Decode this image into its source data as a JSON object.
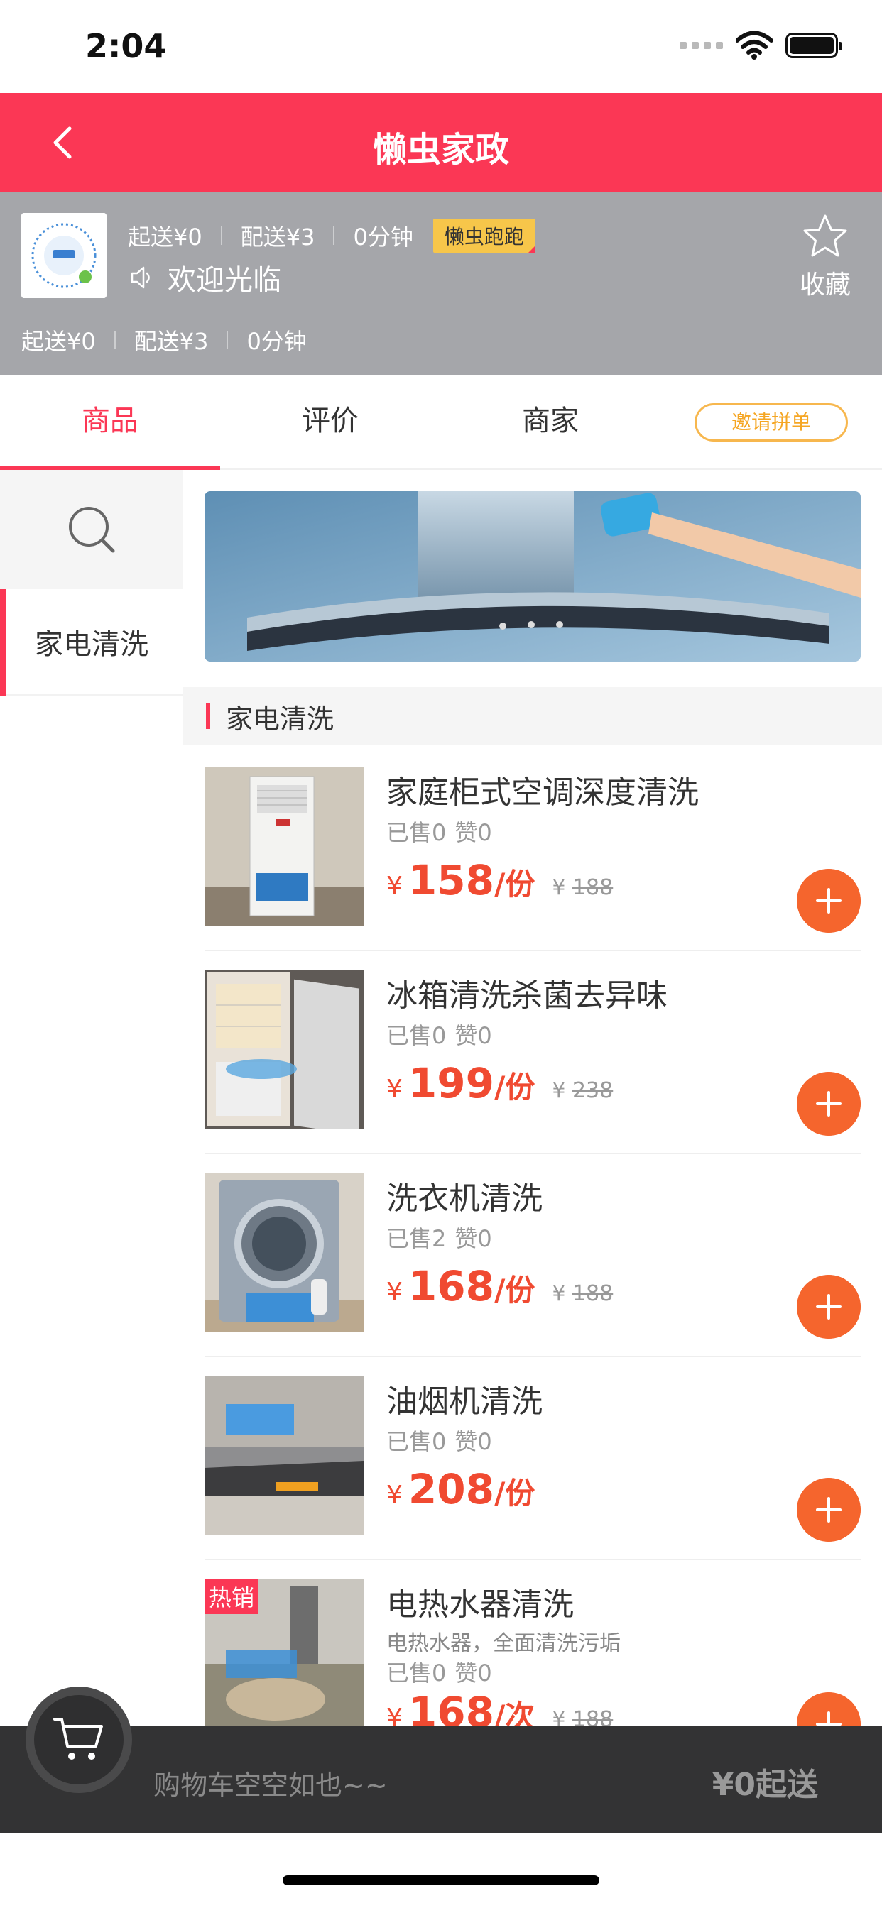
{
  "status_bar": {
    "time": "2:04"
  },
  "nav": {
    "title": "懒虫家政"
  },
  "shop": {
    "line1": {
      "min_order": "起送¥0",
      "delivery_fee": "配送¥3",
      "time": "0分钟",
      "tag": "懒虫跑跑"
    },
    "welcome": "欢迎光临",
    "line2": {
      "min_order": "起送¥0",
      "delivery_fee": "配送¥3",
      "time": "0分钟"
    },
    "favorite_label": "收藏"
  },
  "tabs": [
    {
      "label": "商品",
      "active": true
    },
    {
      "label": "评价",
      "active": false
    },
    {
      "label": "商家",
      "active": false
    }
  ],
  "invite_label": "邀请拼单",
  "sidebar": {
    "items": [
      {
        "label": "家电清洗",
        "active": true
      }
    ]
  },
  "category": {
    "title": "家电清洗"
  },
  "products": [
    {
      "name": "家庭柜式空调深度清洗",
      "sold": "已售0",
      "likes": "赞0",
      "yen": "¥",
      "price": "158",
      "unit": "/份",
      "orig_yen": "¥",
      "orig_price": "188"
    },
    {
      "name": "冰箱清洗杀菌去异味",
      "sold": "已售0",
      "likes": "赞0",
      "yen": "¥",
      "price": "199",
      "unit": "/份",
      "orig_yen": "¥",
      "orig_price": "238"
    },
    {
      "name": "洗衣机清洗",
      "sold": "已售2",
      "likes": "赞0",
      "yen": "¥",
      "price": "168",
      "unit": "/份",
      "orig_yen": "¥",
      "orig_price": "188"
    },
    {
      "name": "油烟机清洗",
      "sold": "已售0",
      "likes": "赞0",
      "yen": "¥",
      "price": "208",
      "unit": "/份"
    },
    {
      "name": "电热水器清洗",
      "desc": "电热水器，全面清洗污垢",
      "sold": "已售0",
      "likes": "赞0",
      "yen": "¥",
      "price": "168",
      "unit": "/次",
      "orig_yen": "¥",
      "orig_price": "188",
      "tag": "热销"
    }
  ],
  "cart": {
    "empty_text": "购物车空空如也~~",
    "min_order": "¥0起送"
  },
  "colors": {
    "accent": "#fb3755",
    "price": "#f04a31",
    "add_button": "#f5652d",
    "shop_header": "#a5a6aa"
  }
}
